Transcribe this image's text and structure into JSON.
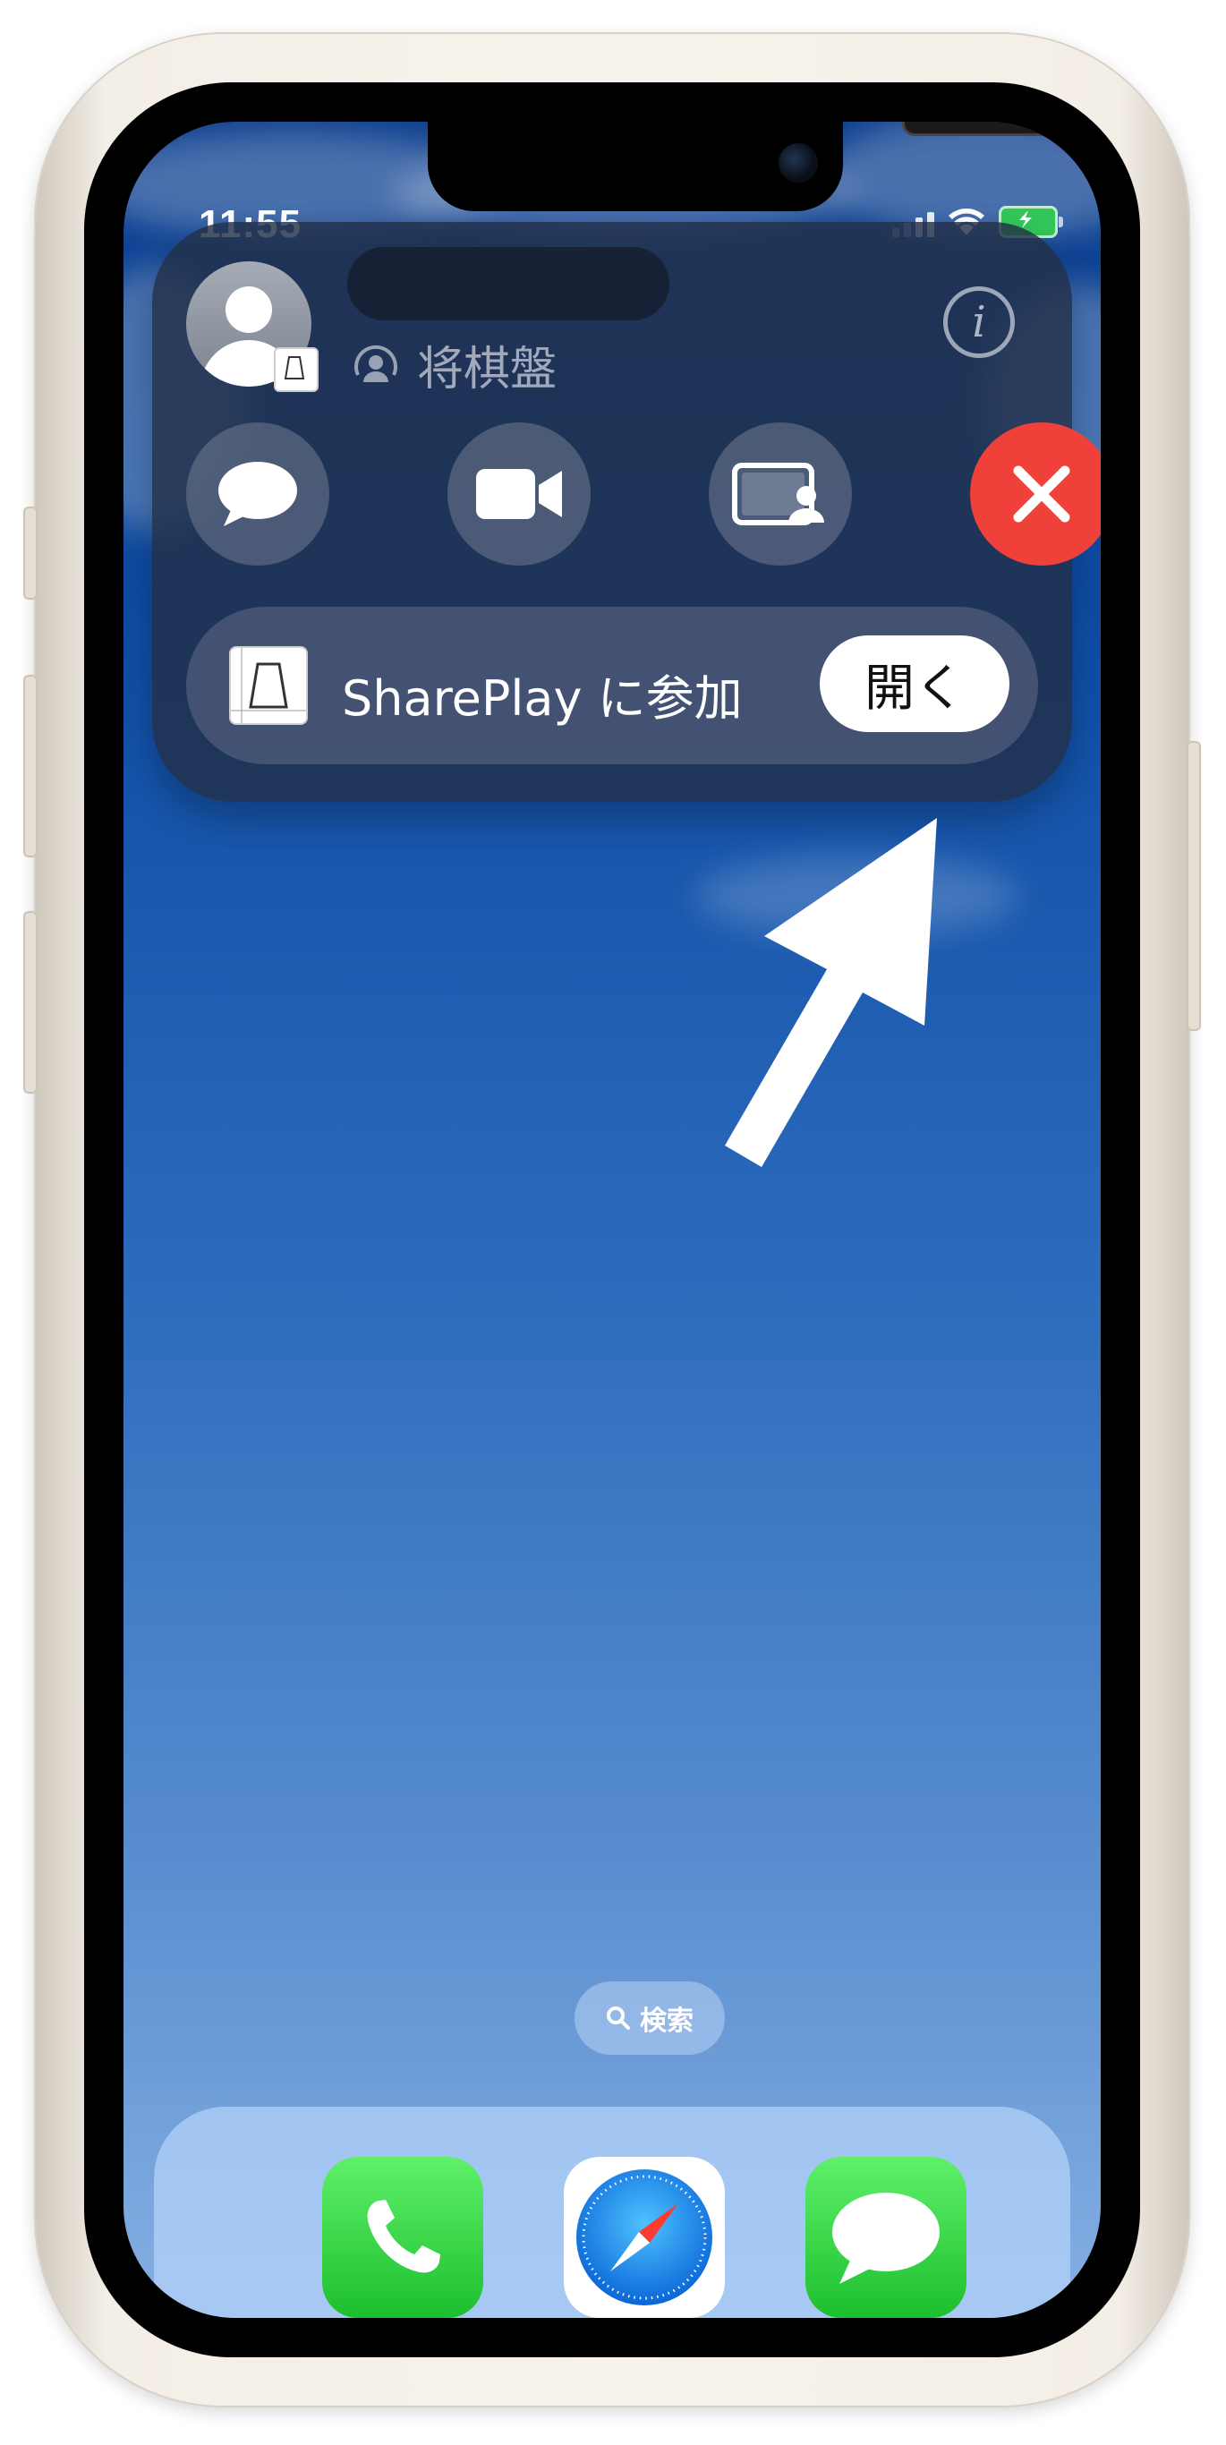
{
  "status_bar": {
    "time": "11:55"
  },
  "call_panel": {
    "subtitle": "将棋盤",
    "info_label": "i",
    "shareplay_label": "SharePlay に参加",
    "open_button": "開く"
  },
  "search": {
    "label": "検索"
  },
  "dock": {
    "apps": [
      "phone-app",
      "safari-app",
      "messages-app"
    ]
  },
  "colors": {
    "end_call": "#f0403a",
    "wallpaper_top": "#0c3e8e",
    "wallpaper_bottom": "#86afe3"
  }
}
